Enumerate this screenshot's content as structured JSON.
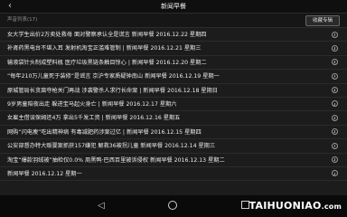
{
  "header": {
    "title": "新闻早餐",
    "back_glyph": "‹"
  },
  "subbar": {
    "count_label": "声音列表(17)",
    "favorite_label": "收藏专辑"
  },
  "items": [
    {
      "title": "女大学生出价2万卖处救母 面对警察承认全是谎言 新闻早餐 2016.12.22 星期四"
    },
    {
      "title": "补肾药黑电台不堪入耳 发射机淘宝正滥难管制 | 新闻早餐 2016.12.21 星期三"
    },
    {
      "title": "输液袋针头制成塑料瓶 医疗垃圾黑链条触目惊心 | 新闻早餐 2016.12.20 星期二"
    },
    {
      "title": "“每年210万儿童死于装修”是谣言 京沪专家质疑钟南山 新闻早餐 2016.12.19 星期一"
    },
    {
      "title": "原城管局长贪腐夺枪关门再战 涉袭警杀人求行长命案 | 新闻早餐 2016.12.18 星期日"
    },
    {
      "title": "9岁男童陪夜出走 躲进宝马起火身亡 | 新闻早餐 2016.12.17 星期六"
    },
    {
      "title": "女雇主借误保姆还4万 拿出5千发工资 | 新闻早餐 2016.12.16 星期五"
    },
    {
      "title": "网购“闪电瘦”吃出精神病 有毒减肥药涉案过亿 | 新闻早餐 2016.12.15 星期四"
    },
    {
      "title": "公安部督办特大贩婴案抓获157嫌犯 解救36被拐儿童 新闻早餐 2016.12.14 星期三"
    },
    {
      "title": "淘宝“爆款羽绒被”抽检仅0.0% 周黑鸭·巴西百里被诉侵权 新闻早餐 2016.12.13 星期二"
    },
    {
      "title": "新闻早餐 2016.12.12 星期一"
    }
  ],
  "navbar": {
    "back_glyph": "◁"
  },
  "watermark": {
    "main": "TAIHUONIAO",
    "suffix": ".com"
  },
  "colors": {
    "background": "#1c1c1c",
    "divider": "#2b2b2b",
    "text": "#ececec"
  }
}
